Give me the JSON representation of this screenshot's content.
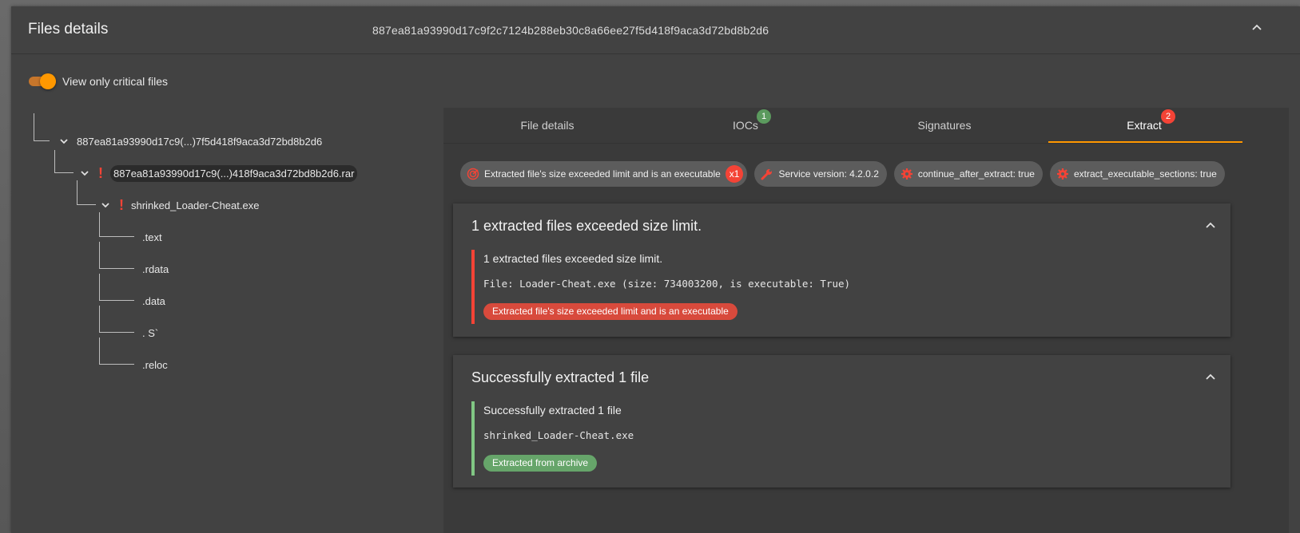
{
  "panel": {
    "title": "Files details",
    "hash": "887ea81a93990d17c9f2c7124b288eb30c8a66ee27f5d418f9aca3d72bd8b2d6"
  },
  "toggle": {
    "label": "View only critical files",
    "checked": true,
    "color": "#ff9800"
  },
  "tree": {
    "root": "887ea81a93990d17c9(...)7f5d418f9aca3d72bd8b2d6",
    "archive": "887ea81a93990d17c9(...)418f9aca3d72bd8b2d6.rar",
    "exe": "shrinked_Loader-Cheat.exe",
    "sections": [
      ".text",
      ".rdata",
      ".data",
      ". S`",
      ".reloc"
    ]
  },
  "tabs": [
    {
      "label": "File details",
      "badge": null
    },
    {
      "label": "IOCs",
      "badge": "1",
      "badge_color": "#5b9a5e"
    },
    {
      "label": "Signatures",
      "badge": null
    },
    {
      "label": "Extract",
      "badge": "2",
      "badge_color": "#f44336",
      "active": true
    }
  ],
  "chips": [
    {
      "label": "Extracted file's size exceeded limit and is an executable",
      "count": "x1",
      "icon": "radar-icon"
    },
    {
      "label": "Service version: 4.2.0.2",
      "icon": "wrench-icon"
    },
    {
      "label": "continue_after_extract: true",
      "icon": "gear-icon"
    },
    {
      "label": "extract_executable_sections: true",
      "icon": "gear-icon"
    }
  ],
  "cards": [
    {
      "title": "1 extracted files exceeded size limit.",
      "body_title": "1 extracted files exceeded size limit.",
      "body_text": "File: Loader-Cheat.exe (size: 734003200, is executable: True)",
      "tag": "Extracted file's size exceeded limit and is an executable",
      "status_color": "#f44336"
    },
    {
      "title": "Successfully extracted 1 file",
      "body_title": "Successfully extracted 1 file",
      "body_text": "shrinked_Loader-Cheat.exe",
      "tag": "Extracted from archive",
      "status_color": "#81c784"
    }
  ]
}
